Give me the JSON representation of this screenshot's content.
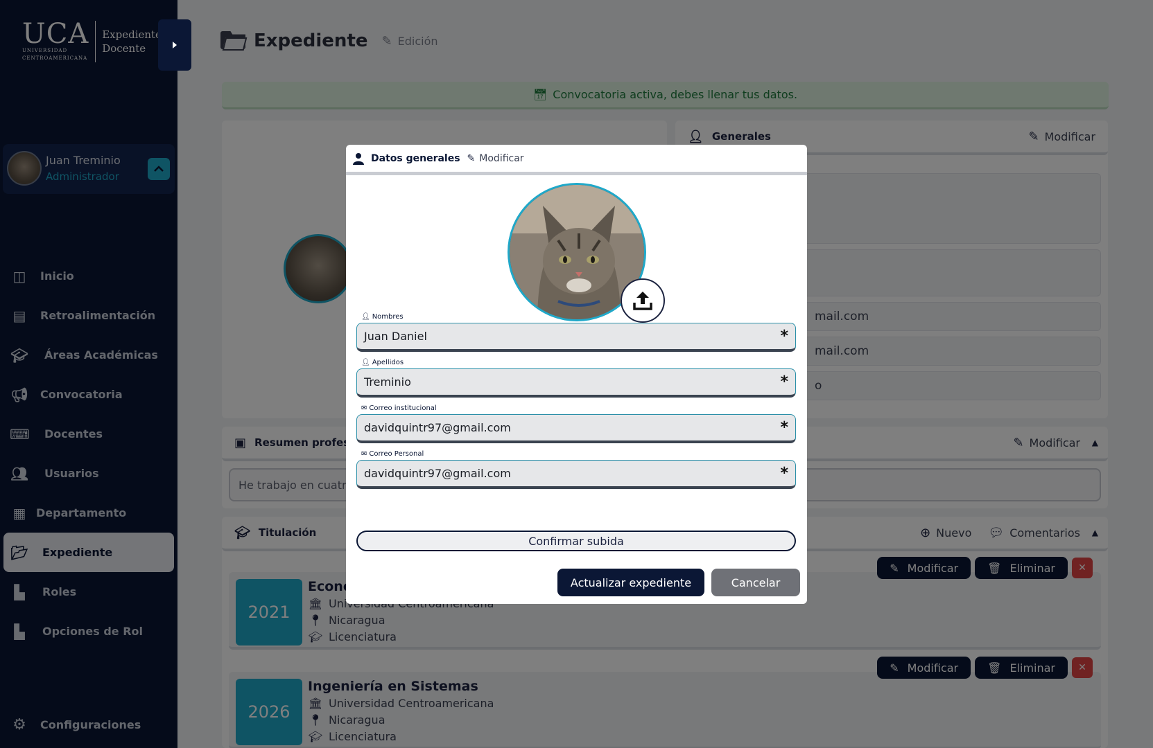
{
  "sidebar": {
    "logo_main": "UCA",
    "logo_sub1": "UNIVERSIDAD",
    "logo_sub2": "CENTROAMERICANA",
    "logo_right1": "Expediente",
    "logo_right2": "Docente",
    "user_name": "Juan Treminio",
    "user_role": "Administrador",
    "items": [
      {
        "label": "Inicio",
        "icon": "columns-icon"
      },
      {
        "label": "Retroalimentación",
        "icon": "book-icon"
      },
      {
        "label": "Áreas Académicas",
        "icon": "graduation-cap-icon"
      },
      {
        "label": "Convocatoria",
        "icon": "megaphone-icon"
      },
      {
        "label": "Docentes",
        "icon": "teacher-icon"
      },
      {
        "label": "Usuarios",
        "icon": "users-icon"
      },
      {
        "label": "Departamento",
        "icon": "building-icon"
      },
      {
        "label": "Expediente",
        "icon": "folder-open-icon"
      },
      {
        "label": "Roles",
        "icon": "roles-icon"
      },
      {
        "label": "Opciones de Rol",
        "icon": "roles-icon"
      }
    ],
    "config_label": "Configuraciones"
  },
  "header": {
    "title": "Expediente",
    "subtitle": "Edición"
  },
  "alert": {
    "text": "Convocatoria activa, debes llenar tus datos."
  },
  "generales": {
    "title": "Generales",
    "modify_label": "Modificar",
    "email_partial_1": "mail.com",
    "email_partial_2": "mail.com",
    "partial_3": "o"
  },
  "resumen": {
    "title": "Resumen profesio",
    "modify_label": "Modificar",
    "text_partial": "He trabajo en cuatr"
  },
  "titulacion": {
    "title": "Titulación",
    "new_label": "Nuevo",
    "comments_label": "Comentarios",
    "modify_label": "Modificar",
    "delete_label": "Eliminar",
    "rows": [
      {
        "year": "2021",
        "title": "Econo",
        "university": "Universidad Centroamericana",
        "country": "Nicaragua",
        "degree": "Licenciatura"
      },
      {
        "year": "2026",
        "title": "Ingeniería en Sistemas",
        "university": "Universidad Centroamericana",
        "country": "Nicaragua",
        "degree": "Licenciatura"
      }
    ]
  },
  "modal": {
    "title": "Datos generales",
    "modify_label": "Modificar",
    "fields": {
      "nombres_label": "Nombres",
      "nombres_value": "Juan Daniel",
      "apellidos_label": "Apellidos",
      "apellidos_value": "Treminio",
      "correo_inst_label": "Correo institucional",
      "correo_inst_value": "davidquintr97@gmail.com",
      "correo_pers_label": "Correo Personal",
      "correo_pers_value": "davidquintr97@gmail.com"
    },
    "required_mark": "*",
    "confirm_label": "Confirmar subida",
    "update_label": "Actualizar expediente",
    "cancel_label": "Cancelar"
  },
  "colors": {
    "sidebar_bg": "#0b1735",
    "accent": "#1fa8c9",
    "danger": "#e04545",
    "alert_bg": "#dff2e1"
  }
}
